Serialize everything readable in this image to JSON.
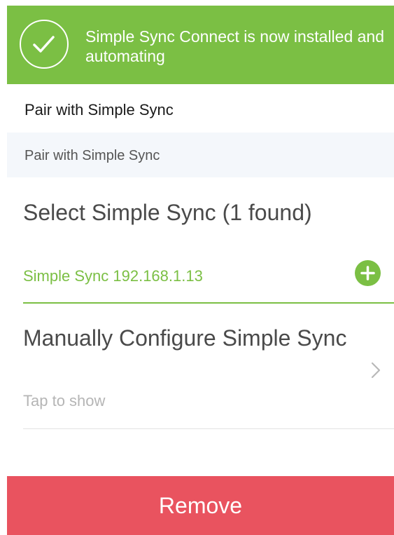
{
  "banner": {
    "message": "Simple Sync Connect is now installed and automating",
    "icon": "checkmark-circle-icon",
    "color": "#7bbf44"
  },
  "page": {
    "title": "Pair with Simple Sync"
  },
  "section": {
    "header": "Pair with Simple Sync"
  },
  "select": {
    "title": "Select Simple Sync (1 found)",
    "device": "Simple Sync 192.168.1.13",
    "add_icon": "plus-circle-icon"
  },
  "manual": {
    "title": "Manually Configure Simple Sync",
    "subtitle": "Tap to show",
    "icon": "chevron-right-icon"
  },
  "actions": {
    "remove_label": "Remove",
    "remove_color": "#e9535f"
  }
}
